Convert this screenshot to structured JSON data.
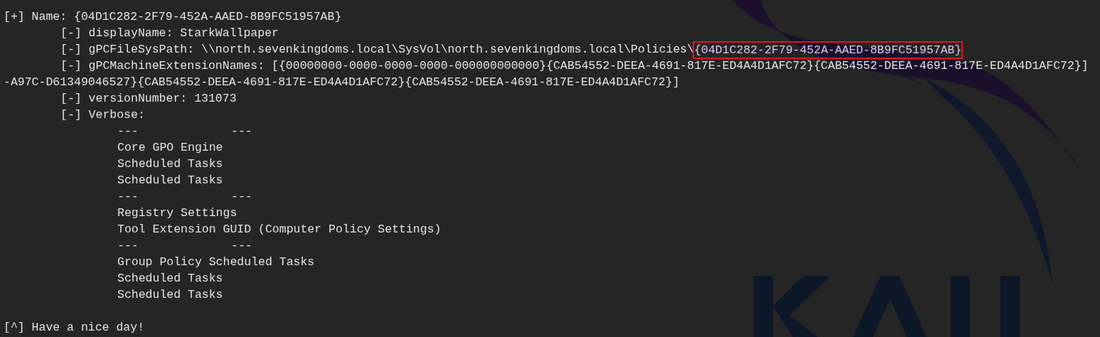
{
  "terminal": {
    "lines": [
      {
        "kind": "result",
        "text": "[+] Name: {04D1C282-2F79-452A-AAED-8B9FC51957AB}"
      },
      {
        "kind": "attribute",
        "text": "[-] displayName: StarkWallpaper"
      },
      {
        "kind": "attribute",
        "text": "[-] gPCFileSysPath: \\\\north.sevenkingdoms.local\\SysVol\\north.sevenkingdoms.local\\Policies\\",
        "highlight": "{04D1C282-2F79-452A-AAED-8B9FC51957AB}"
      },
      {
        "kind": "attribute",
        "text": "[-] gPCMachineExtensionNames: [{00000000-0000-0000-0000-000000000000}{CAB54552-DEEA-4691-817E-ED4A4D1AFC72}{CAB54552-DEEA-4691-817E-ED4A4D1AFC72}]"
      },
      {
        "kind": "wrapped",
        "text": "-A97C-D61349046527}{CAB54552-DEEA-4691-817E-ED4A4D1AFC72}{CAB54552-DEEA-4691-817E-ED4A4D1AFC72}]"
      },
      {
        "kind": "attribute",
        "text": "[-] versionNumber: 131073"
      },
      {
        "kind": "attribute",
        "text": "[-] Verbose:"
      },
      {
        "kind": "separator",
        "text": "---",
        "text_2": "---"
      },
      {
        "kind": "verbose",
        "text": "Core GPO Engine"
      },
      {
        "kind": "verbose",
        "text": "Scheduled Tasks"
      },
      {
        "kind": "verbose",
        "text": "Scheduled Tasks"
      },
      {
        "kind": "separator",
        "text": "---",
        "text_2": "---"
      },
      {
        "kind": "verbose",
        "text": "Registry Settings"
      },
      {
        "kind": "verbose",
        "text": "Tool Extension GUID (Computer Policy Settings)"
      },
      {
        "kind": "separator",
        "text": "---",
        "text_2": "---"
      },
      {
        "kind": "verbose",
        "text": "Group Policy Scheduled Tasks"
      },
      {
        "kind": "verbose",
        "text": "Scheduled Tasks"
      },
      {
        "kind": "verbose",
        "text": "Scheduled Tasks"
      }
    ],
    "footer": "[^] Have a nice day!"
  }
}
